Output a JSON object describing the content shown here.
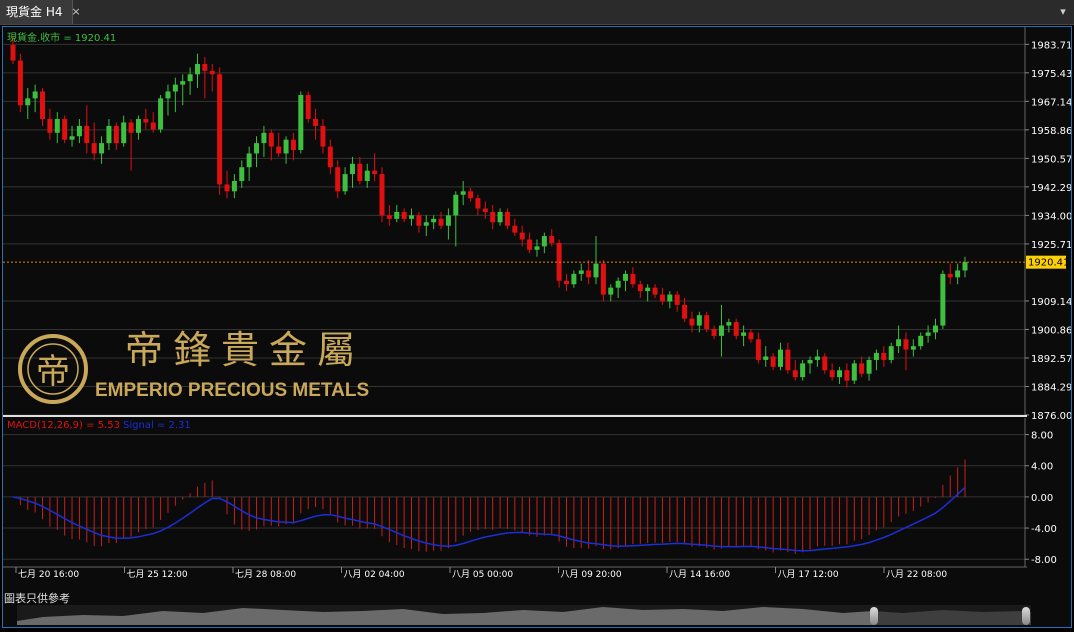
{
  "tab": {
    "title": "現貨金 H4",
    "close_icon": "×",
    "collapse_icon": "▾"
  },
  "colors": {
    "background": "#0b0b0b",
    "grid": "#333333",
    "up": "#3fbf3f",
    "down": "#e01010",
    "macd_hist": "#c81e1e",
    "signal": "#1a2fd6",
    "price_line": "#d98c1a",
    "axis_text": "#ffffff",
    "price_label_bg": "#ffd000",
    "logo_gold": "#c9a85a"
  },
  "price_panel": {
    "label": "現貨金.收市 = 1920.41",
    "current_price": "1920.41",
    "y_ticks": [
      "1983.71",
      "1975.43",
      "1967.14",
      "1958.86",
      "1950.57",
      "1942.29",
      "1934.00",
      "1925.71",
      "1909.14",
      "1900.86",
      "1892.57",
      "1884.29",
      "1876.00"
    ]
  },
  "macd_panel": {
    "label_macd": "MACD(12,26,9) = 5.53",
    "label_signal": "Signal = 2.31",
    "y_ticks": [
      "8.00",
      "4.00",
      "0.00",
      "-4.00",
      "-8.00"
    ]
  },
  "x_ticks": [
    "七月 20 16:00",
    "七月 25 12:00",
    "七月 28 08:00",
    "八月 02 04:00",
    "八月 05 00:00",
    "八月 09 20:00",
    "八月 14 16:00",
    "八月 17 12:00",
    "八月 22 08:00"
  ],
  "logo": {
    "chinese": "帝鋒貴金屬",
    "english": "EMPERIO PRECIOUS METALS"
  },
  "caption": "圖表只供參考",
  "chart_data": [
    {
      "type": "candlestick",
      "title": "現貨金 H4",
      "series_name": "現貨金.收市",
      "last": 1920.41,
      "ylim": [
        1876.0,
        1987.0
      ],
      "candles": [
        [
          1983.5,
          1986.0,
          1978.0,
          1979.0
        ],
        [
          1979.0,
          1981.0,
          1964.0,
          1966.0
        ],
        [
          1966.0,
          1971.0,
          1962.0,
          1968.0
        ],
        [
          1968.0,
          1972.0,
          1964.0,
          1970.0
        ],
        [
          1970.0,
          1971.0,
          1960.0,
          1962.0
        ],
        [
          1962.0,
          1965.0,
          1956.0,
          1958.0
        ],
        [
          1958.0,
          1964.0,
          1955.0,
          1962.0
        ],
        [
          1962.0,
          1963.0,
          1955.0,
          1956.0
        ],
        [
          1956.0,
          1960.0,
          1954.0,
          1957.0
        ],
        [
          1957.0,
          1962.0,
          1955.0,
          1960.0
        ],
        [
          1960.0,
          1966.0,
          1952.0,
          1955.0
        ],
        [
          1955.0,
          1961.0,
          1950.0,
          1952.0
        ],
        [
          1952.0,
          1957.0,
          1949.0,
          1955.0
        ],
        [
          1955.0,
          1962.0,
          1953.0,
          1960.0
        ],
        [
          1960.0,
          1961.0,
          1953.0,
          1955.0
        ],
        [
          1955.0,
          1963.0,
          1954.0,
          1961.0
        ],
        [
          1961.0,
          1962.0,
          1947.0,
          1958.0
        ],
        [
          1958.0,
          1963.0,
          1956.0,
          1962.0
        ],
        [
          1962.0,
          1965.0,
          1959.0,
          1961.0
        ],
        [
          1961.0,
          1964.0,
          1958.0,
          1959.0
        ],
        [
          1959.0,
          1969.0,
          1958.0,
          1968.0
        ],
        [
          1968.0,
          1972.0,
          1963.0,
          1970.0
        ],
        [
          1970.0,
          1974.0,
          1964.0,
          1972.0
        ],
        [
          1972.0,
          1975.0,
          1966.0,
          1973.0
        ],
        [
          1973.0,
          1977.0,
          1969.0,
          1975.0
        ],
        [
          1975.0,
          1981.0,
          1971.0,
          1978.0
        ],
        [
          1978.0,
          1980.0,
          1968.0,
          1976.0
        ],
        [
          1976.0,
          1978.0,
          1970.0,
          1975.0
        ],
        [
          1975.0,
          1977.0,
          1940.0,
          1943.0
        ],
        [
          1943.0,
          1947.0,
          1939.0,
          1941.0
        ],
        [
          1941.0,
          1946.0,
          1939.0,
          1944.0
        ],
        [
          1944.0,
          1950.0,
          1942.0,
          1948.0
        ],
        [
          1948.0,
          1954.0,
          1944.0,
          1952.0
        ],
        [
          1952.0,
          1957.0,
          1948.0,
          1955.0
        ],
        [
          1955.0,
          1960.0,
          1951.0,
          1958.0
        ],
        [
          1958.0,
          1959.0,
          1950.0,
          1954.0
        ],
        [
          1954.0,
          1958.0,
          1951.0,
          1952.0
        ],
        [
          1952.0,
          1957.0,
          1949.0,
          1956.0
        ],
        [
          1956.0,
          1958.0,
          1950.0,
          1953.0
        ],
        [
          1953.0,
          1970.0,
          1952.0,
          1969.0
        ],
        [
          1969.0,
          1970.0,
          1961.0,
          1962.0
        ],
        [
          1962.0,
          1965.0,
          1956.0,
          1960.0
        ],
        [
          1960.0,
          1962.0,
          1952.0,
          1954.0
        ],
        [
          1954.0,
          1956.0,
          1946.0,
          1948.0
        ],
        [
          1948.0,
          1950.0,
          1939.0,
          1941.0
        ],
        [
          1941.0,
          1948.0,
          1940.0,
          1946.0
        ],
        [
          1946.0,
          1951.0,
          1942.0,
          1949.0
        ],
        [
          1949.0,
          1951.0,
          1943.0,
          1944.0
        ],
        [
          1944.0,
          1949.0,
          1942.0,
          1947.0
        ],
        [
          1947.0,
          1952.0,
          1944.0,
          1946.0
        ],
        [
          1946.0,
          1948.0,
          1932.0,
          1934.0
        ],
        [
          1934.0,
          1937.0,
          1931.0,
          1933.0
        ],
        [
          1933.0,
          1937.0,
          1932.0,
          1935.0
        ],
        [
          1935.0,
          1936.0,
          1932.0,
          1933.0
        ],
        [
          1933.0,
          1936.0,
          1931.0,
          1934.0
        ],
        [
          1934.0,
          1935.0,
          1929.0,
          1931.0
        ],
        [
          1931.0,
          1934.0,
          1928.0,
          1932.0
        ],
        [
          1932.0,
          1934.0,
          1930.0,
          1933.0
        ],
        [
          1933.0,
          1935.0,
          1930.0,
          1931.0
        ],
        [
          1931.0,
          1936.0,
          1927.0,
          1934.0
        ],
        [
          1934.0,
          1941.0,
          1925.0,
          1940.0
        ],
        [
          1940.0,
          1944.0,
          1937.0,
          1941.0
        ],
        [
          1941.0,
          1942.0,
          1938.0,
          1939.0
        ],
        [
          1939.0,
          1940.0,
          1934.0,
          1936.0
        ],
        [
          1936.0,
          1938.0,
          1933.0,
          1935.0
        ],
        [
          1935.0,
          1937.0,
          1930.0,
          1932.0
        ],
        [
          1932.0,
          1936.0,
          1931.0,
          1935.0
        ],
        [
          1935.0,
          1936.0,
          1930.0,
          1931.0
        ],
        [
          1931.0,
          1933.0,
          1928.0,
          1929.0
        ],
        [
          1929.0,
          1931.0,
          1925.0,
          1927.0
        ],
        [
          1927.0,
          1929.0,
          1923.0,
          1924.0
        ],
        [
          1924.0,
          1927.0,
          1922.0,
          1925.0
        ],
        [
          1925.0,
          1929.0,
          1923.0,
          1928.0
        ],
        [
          1928.0,
          1930.0,
          1925.0,
          1926.0
        ],
        [
          1926.0,
          1927.0,
          1913.0,
          1915.0
        ],
        [
          1915.0,
          1917.0,
          1912.0,
          1914.0
        ],
        [
          1914.0,
          1918.0,
          1913.0,
          1917.0
        ],
        [
          1917.0,
          1920.0,
          1915.0,
          1918.0
        ],
        [
          1918.0,
          1921.0,
          1914.0,
          1916.0
        ],
        [
          1916.0,
          1928.0,
          1914.0,
          1920.0
        ],
        [
          1920.0,
          1921.0,
          1909.0,
          1911.0
        ],
        [
          1911.0,
          1914.0,
          1909.0,
          1913.0
        ],
        [
          1913.0,
          1916.0,
          1910.0,
          1915.0
        ],
        [
          1915.0,
          1918.0,
          1912.0,
          1917.0
        ],
        [
          1917.0,
          1919.0,
          1913.0,
          1914.0
        ],
        [
          1914.0,
          1915.0,
          1910.0,
          1912.0
        ],
        [
          1912.0,
          1914.0,
          1909.0,
          1913.0
        ],
        [
          1913.0,
          1914.0,
          1910.0,
          1911.0
        ],
        [
          1911.0,
          1913.0,
          1908.0,
          1909.0
        ],
        [
          1909.0,
          1912.0,
          1907.0,
          1911.0
        ],
        [
          1911.0,
          1912.0,
          1906.0,
          1908.0
        ],
        [
          1908.0,
          1910.0,
          1903.0,
          1904.0
        ],
        [
          1904.0,
          1906.0,
          1900.0,
          1902.0
        ],
        [
          1902.0,
          1906.0,
          1900.0,
          1905.0
        ],
        [
          1905.0,
          1906.0,
          1900.0,
          1901.0
        ],
        [
          1901.0,
          1902.0,
          1898.0,
          1899.0
        ],
        [
          1899.0,
          1908.0,
          1893.0,
          1902.0
        ],
        [
          1902.0,
          1904.0,
          1900.0,
          1903.0
        ],
        [
          1903.0,
          1904.0,
          1898.0,
          1899.0
        ],
        [
          1899.0,
          1902.0,
          1896.0,
          1900.0
        ],
        [
          1900.0,
          1901.0,
          1897.0,
          1898.0
        ],
        [
          1898.0,
          1900.0,
          1891.0,
          1892.0
        ],
        [
          1892.0,
          1896.0,
          1890.0,
          1893.0
        ],
        [
          1893.0,
          1894.0,
          1889.0,
          1890.0
        ],
        [
          1890.0,
          1897.0,
          1889.0,
          1895.0
        ],
        [
          1895.0,
          1897.0,
          1888.0,
          1889.0
        ],
        [
          1889.0,
          1892.0,
          1886.0,
          1887.0
        ],
        [
          1887.0,
          1892.0,
          1886.0,
          1891.0
        ],
        [
          1891.0,
          1893.0,
          1888.0,
          1892.0
        ],
        [
          1892.0,
          1895.0,
          1890.0,
          1893.0
        ],
        [
          1893.0,
          1894.0,
          1888.0,
          1889.0
        ],
        [
          1889.0,
          1891.0,
          1886.0,
          1887.0
        ],
        [
          1887.0,
          1890.0,
          1885.0,
          1889.0
        ],
        [
          1889.0,
          1891.0,
          1884.0,
          1886.0
        ],
        [
          1886.0,
          1892.0,
          1885.0,
          1891.0
        ],
        [
          1891.0,
          1893.0,
          1887.0,
          1888.0
        ],
        [
          1888.0,
          1893.0,
          1886.0,
          1892.0
        ],
        [
          1892.0,
          1895.0,
          1889.0,
          1894.0
        ],
        [
          1894.0,
          1896.0,
          1890.0,
          1892.0
        ],
        [
          1892.0,
          1897.0,
          1891.0,
          1896.0
        ],
        [
          1896.0,
          1902.0,
          1894.0,
          1898.0
        ],
        [
          1898.0,
          1900.0,
          1889.0,
          1895.0
        ],
        [
          1895.0,
          1898.0,
          1893.0,
          1896.0
        ],
        [
          1896.0,
          1900.0,
          1895.0,
          1899.0
        ],
        [
          1899.0,
          1902.0,
          1897.0,
          1900.0
        ],
        [
          1900.0,
          1904.0,
          1898.0,
          1902.0
        ],
        [
          1902.0,
          1918.0,
          1901.0,
          1917.0
        ],
        [
          1917.0,
          1920.0,
          1914.0,
          1916.0
        ],
        [
          1916.0,
          1920.0,
          1914.0,
          1918.0
        ],
        [
          1918.0,
          1922.0,
          1916.0,
          1920.41
        ]
      ]
    },
    {
      "type": "bar+line",
      "title": "MACD(12,26,9)",
      "macd_last": 5.53,
      "signal_last": 2.31,
      "ylim": [
        -9.0,
        10.0
      ]
    }
  ]
}
